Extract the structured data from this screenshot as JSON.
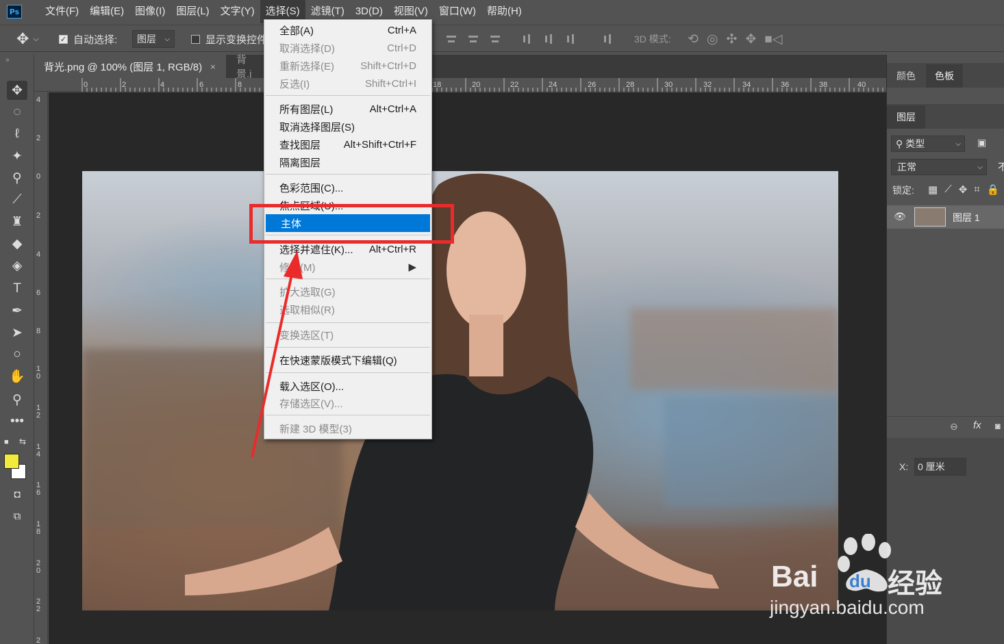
{
  "app": {
    "logo_text": "Ps"
  },
  "menubar": {
    "items": [
      "文件(F)",
      "编辑(E)",
      "图像(I)",
      "图层(L)",
      "文字(Y)",
      "选择(S)",
      "滤镜(T)",
      "3D(D)",
      "视图(V)",
      "窗口(W)",
      "帮助(H)"
    ],
    "active_index": 5
  },
  "options": {
    "auto_select_label": "自动选择:",
    "auto_select_checked": true,
    "auto_select_target": "图层",
    "show_transform_label": "显示变换控件",
    "mode_3d_label": "3D 模式:"
  },
  "document_tabs": [
    {
      "title": "背光.png @ 100% (图层 1, RGB/8)",
      "close": "×",
      "active": true
    },
    {
      "title": "背景.j",
      "active": false
    }
  ],
  "rulers": {
    "horizontal": [
      "0",
      "2",
      "4",
      "6",
      "8",
      "18",
      "20",
      "22",
      "24",
      "26",
      "28",
      "30",
      "32",
      "34",
      "36",
      "38",
      "40"
    ],
    "vertical": [
      "4",
      "2",
      "0",
      "2",
      "4",
      "6",
      "8",
      "1\n0",
      "1\n2",
      "1\n4",
      "1\n6",
      "1\n8",
      "2\n0",
      "2\n2",
      "2"
    ]
  },
  "select_menu": {
    "items": [
      {
        "label": "全部(A)",
        "shortcut": "Ctrl+A",
        "disabled": false
      },
      {
        "label": "取消选择(D)",
        "shortcut": "Ctrl+D",
        "disabled": true
      },
      {
        "label": "重新选择(E)",
        "shortcut": "Shift+Ctrl+D",
        "disabled": true
      },
      {
        "label": "反选(I)",
        "shortcut": "Shift+Ctrl+I",
        "disabled": true
      },
      {
        "label": "所有图层(L)",
        "shortcut": "Alt+Ctrl+A",
        "disabled": false
      },
      {
        "label": "取消选择图层(S)",
        "shortcut": "",
        "disabled": false
      },
      {
        "label": "查找图层",
        "shortcut": "Alt+Shift+Ctrl+F",
        "disabled": false
      },
      {
        "label": "隔离图层",
        "shortcut": "",
        "disabled": false
      },
      {
        "label": "色彩范围(C)...",
        "shortcut": "",
        "disabled": false
      },
      {
        "label": "焦点区域(U)...",
        "shortcut": "",
        "disabled": false
      },
      {
        "label": "主体",
        "shortcut": "",
        "disabled": false,
        "highlighted": true
      },
      {
        "label": "选择并遮住(K)...",
        "shortcut": "Alt+Ctrl+R",
        "disabled": false
      },
      {
        "label": "修改(M)",
        "shortcut": "▶",
        "disabled": true
      },
      {
        "label": "扩大选取(G)",
        "shortcut": "",
        "disabled": true
      },
      {
        "label": "选取相似(R)",
        "shortcut": "",
        "disabled": true
      },
      {
        "label": "变换选区(T)",
        "shortcut": "",
        "disabled": true
      },
      {
        "label": "在快速蒙版模式下编辑(Q)",
        "shortcut": "",
        "disabled": false
      },
      {
        "label": "载入选区(O)...",
        "shortcut": "",
        "disabled": false
      },
      {
        "label": "存储选区(V)...",
        "shortcut": "",
        "disabled": true
      },
      {
        "label": "新建 3D 模型(3)",
        "shortcut": "",
        "disabled": true
      }
    ]
  },
  "right_panel": {
    "top_tabs": [
      "颜色",
      "色板"
    ],
    "active_top_tab": "色板",
    "layers_tab": "图层",
    "filter_kind": "类型",
    "blend_mode": "正常",
    "opacity_label_partial": "不",
    "lock_label": "锁定:",
    "layers": [
      {
        "name": "图层 1",
        "visible": true
      }
    ],
    "footer_fx": "fx",
    "x_label": "X:",
    "x_value": "0 厘米"
  },
  "watermark": {
    "brand": "Bai",
    "brand2": "经验",
    "url": "jingyan.baidu.com"
  },
  "colors": {
    "foreground": "#f2e93d",
    "background": "#ffffff",
    "highlight": "#0078d7",
    "annotation": "#ea2b2b"
  }
}
